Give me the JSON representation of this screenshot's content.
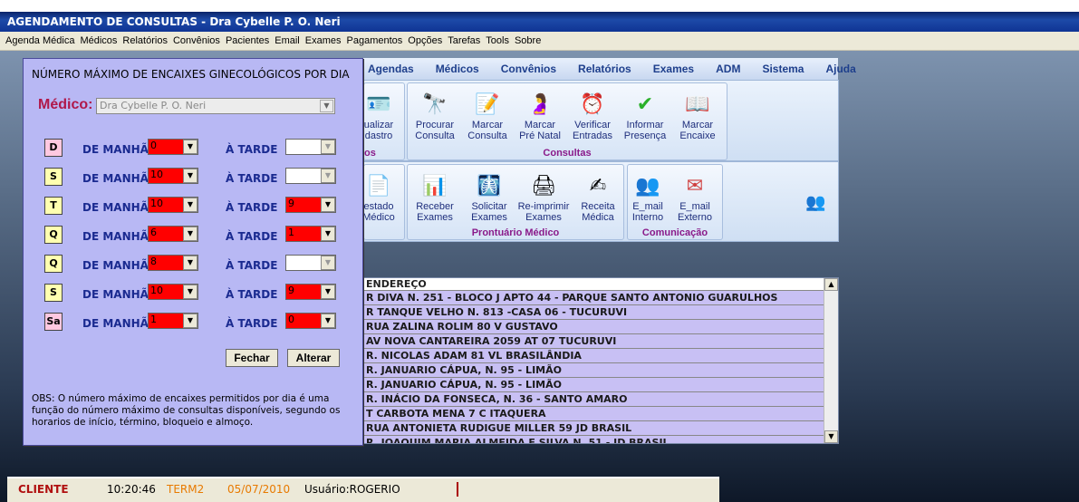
{
  "window": {
    "title": "AGENDAMENTO DE CONSULTAS - Dra Cybelle P. O. Neri"
  },
  "menubar": [
    "Agenda Médica",
    "Médicos",
    "Relatórios",
    "Convênios",
    "Pacientes",
    "Email",
    "Exames",
    "Pagamentos",
    "Opções",
    "Tarefas",
    "Tools",
    "Sobre"
  ],
  "navbar": [
    "Agendas",
    "Médicos",
    "Convênios",
    "Relatórios",
    "Exames",
    "ADM",
    "Sistema",
    "Ajuda"
  ],
  "toolbar1": {
    "partial_group_title": "os",
    "group_title": "Consultas",
    "partial_tool": [
      "ualizar",
      "dastro"
    ],
    "tools": [
      {
        "line1": "Procurar",
        "line2": "Consulta",
        "icon": "binoculars-icon"
      },
      {
        "line1": "Marcar",
        "line2": "Consulta",
        "icon": "notepad-pen-icon"
      },
      {
        "line1": "Marcar",
        "line2": "Pré Natal",
        "icon": "pregnancy-icon"
      },
      {
        "line1": "Verificar",
        "line2": "Entradas",
        "icon": "clock-bag-icon"
      },
      {
        "line1": "Informar",
        "line2": "Presença",
        "icon": "checkmark-icon"
      },
      {
        "line1": "Marcar",
        "line2": "Encaixe",
        "icon": "book-icon"
      }
    ]
  },
  "toolbar2": {
    "group_title_1": "Prontuário Médico",
    "group_title_2": "Comunicação",
    "partial_tool": [
      "estado",
      "Médico"
    ],
    "tools": [
      {
        "line1": "Receber",
        "line2": "Exames",
        "icon": "chart-icon"
      },
      {
        "line1": "Solicitar",
        "line2": "Exames",
        "icon": "xray-icon"
      },
      {
        "line1": "Re-imprimir",
        "line2": "Exames",
        "icon": "printer-icon"
      },
      {
        "line1": "Receita",
        "line2": "Médica",
        "icon": "prescription-pen-icon"
      }
    ],
    "comm_tools": [
      {
        "line1": "E_mail",
        "line2": "Interno",
        "icon": "people-mail-icon"
      },
      {
        "line1": "E_mail",
        "line2": "Externo",
        "icon": "envelope-icon"
      }
    ],
    "users_icon": "users-icon"
  },
  "grid": {
    "header": "ENDEREÇO",
    "rows": [
      "R DIVA N. 251 - BLOCO J APTO 44  - PARQUE SANTO ANTONIO GUARULHOS",
      "R TANQUE VELHO N. 813 -CASA 06 - TUCURUVI",
      "RUA ZALINA ROLIM 80 V GUSTAVO",
      "AV NOVA CANTAREIRA 2059 AT 07 TUCURUVI",
      "R. NICOLAS ADAM  81 VL BRASILÂNDIA",
      "R. JANUARIO CÁPUA, N. 95 -  LIMÃO",
      "R. JANUARIO CÁPUA, N. 95 - LIMÃO",
      "R. INÁCIO DA FONSECA, N. 36 - SANTO AMARO",
      "T CARBOTA MENA 7 C ITAQUERA",
      "RUA ANTONIETA RUDIGUE MILLER 59 JD BRASIL",
      "R. JOAQUIM MARIA ALMEIDA E SILVA N. 51 -  JD BRASIL"
    ]
  },
  "dialog": {
    "title": "NÚMERO MÁXIMO DE ENCAIXES GINECOLÓGICOS POR DIA",
    "medico_label": "Médico:",
    "medico_value": "Dra Cybelle P. O. Neri",
    "morning_label": "DE MANHÃ",
    "afternoon_label": "À TARDE",
    "days": [
      {
        "day": "D",
        "day_color": "#ffc8e0",
        "morning": "0",
        "afternoon": ""
      },
      {
        "day": "S",
        "day_color": "#ffffb0",
        "morning": "10",
        "afternoon": ""
      },
      {
        "day": "T",
        "day_color": "#ffffb0",
        "morning": "10",
        "afternoon": "9"
      },
      {
        "day": "Q",
        "day_color": "#ffffb0",
        "morning": "6",
        "afternoon": "1"
      },
      {
        "day": "Q",
        "day_color": "#ffffb0",
        "morning": "8",
        "afternoon": ""
      },
      {
        "day": "S",
        "day_color": "#ffffb0",
        "morning": "10",
        "afternoon": "9"
      },
      {
        "day": "Sa",
        "day_color": "#ffc8e0",
        "morning": "1",
        "afternoon": "0"
      }
    ],
    "close_button": "Fechar",
    "alter_button": "Alterar",
    "obs": "OBS: O número máximo de encaixes permitidos por dia é uma função do número máximo de consultas disponíveis, segundo os horarios de início, término, bloqueio e almoço."
  },
  "statusbar": {
    "client": "CLIENTE",
    "time": "10:20:46",
    "terminal": "TERM2",
    "date": "05/07/2010",
    "user": "Usuário:ROGERIO"
  },
  "colors": {
    "dialog_bg": "#b8b8f4",
    "grid_row": "#c8c0f4",
    "nav_text": "#1e3f8c",
    "group_title": "#8a1a8a",
    "status_orange": "#e87a00",
    "status_red": "#b01010"
  }
}
